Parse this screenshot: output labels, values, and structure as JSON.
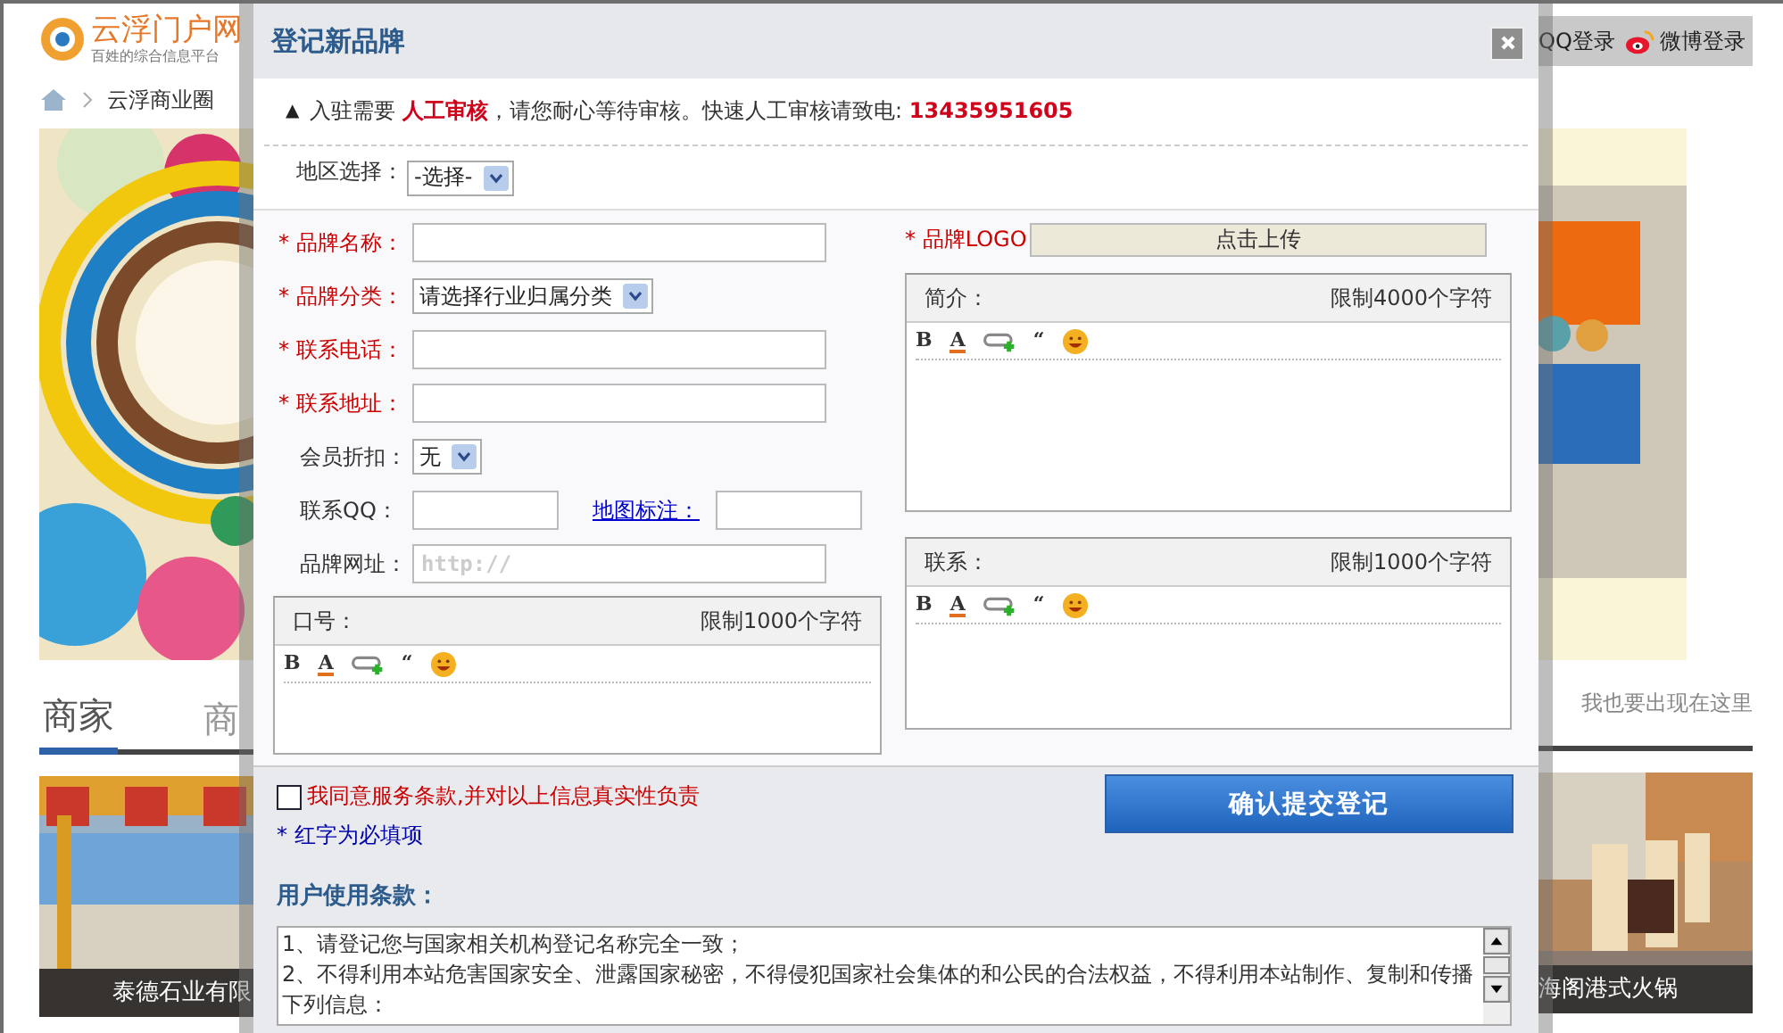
{
  "background_page": {
    "logo": {
      "name": "云浮门户网",
      "tagline": "百姓的综合信息平台"
    },
    "login_links": [
      {
        "kind": "qq",
        "label": "QQ登录"
      },
      {
        "kind": "weibo",
        "label": "微博登录"
      }
    ],
    "breadcrumb": [
      "云浮商业圈"
    ],
    "tabs": [
      {
        "label": "商家",
        "selected": true
      },
      {
        "label": "商",
        "selected": false
      }
    ],
    "promo_link": "我也要出现在这里",
    "listings": [
      {
        "caption": "泰德石业有限"
      },
      {
        "caption": "海阁港式火锅"
      }
    ]
  },
  "dialog": {
    "title": "登记新品牌",
    "notice_icon": "▲",
    "notice": "入驻需要 **人工审核**，请您耐心等待审核。快速人工审核请致电: **13435951605**",
    "region": {
      "label": "地区选择：",
      "value": "-选择-"
    },
    "left": {
      "fields": [
        {
          "label": "* 品牌名称：",
          "required": true,
          "kind": "text"
        },
        {
          "label": "* 品牌分类：",
          "required": true,
          "kind": "select",
          "value": "请选择行业归属分类"
        },
        {
          "label": "* 联系电话：",
          "required": true,
          "kind": "text"
        },
        {
          "label": "* 联系地址：",
          "required": true,
          "kind": "text"
        },
        {
          "label": "会员折扣：",
          "required": false,
          "kind": "select",
          "value": "无"
        },
        {
          "label": "联系QQ：",
          "required": false,
          "kind": "short",
          "link": "地图标注："
        },
        {
          "label": "品牌网址：",
          "required": false,
          "kind": "text",
          "placeholder": "http://"
        }
      ],
      "editor": {
        "label": "口号：",
        "limit": "限制1000个字符",
        "toolbar": [
          {
            "kind": "bold",
            "glyph": "B"
          },
          {
            "kind": "color",
            "glyph": "A"
          },
          {
            "kind": "link"
          },
          {
            "kind": "quote",
            "glyph": "“"
          },
          {
            "kind": "emoji"
          }
        ]
      }
    },
    "right": {
      "logo_upload": {
        "label": "* 品牌LOGO",
        "required": true,
        "button": "点击上传"
      },
      "editors": [
        {
          "label": "简介：",
          "limit": "限制4000个字符",
          "toolbar": [
            {
              "kind": "bold",
              "glyph": "B"
            },
            {
              "kind": "color",
              "glyph": "A"
            },
            {
              "kind": "link"
            },
            {
              "kind": "quote",
              "glyph": "“"
            },
            {
              "kind": "emoji"
            }
          ]
        },
        {
          "label": "联系：",
          "limit": "限制1000个字符",
          "toolbar": [
            {
              "kind": "bold",
              "glyph": "B"
            },
            {
              "kind": "color",
              "glyph": "A"
            },
            {
              "kind": "link"
            },
            {
              "kind": "quote",
              "glyph": "“"
            },
            {
              "kind": "emoji"
            }
          ]
        }
      ]
    },
    "agree": {
      "label": "我同意服务条款,并对以上信息真实性负责",
      "checked": false
    },
    "required_note": "* 红字为必填项",
    "submit": "确认提交登记",
    "terms": {
      "title": "用户使用条款：",
      "lines": [
        "1、请登记您与国家相关机构登记名称完全一致；",
        "2、不得利用本站危害国家安全、泄露国家秘密，不得侵犯国家社会集体的和公民的合法权益，不得利用本站制作、复制和传播下列信息："
      ]
    }
  }
}
